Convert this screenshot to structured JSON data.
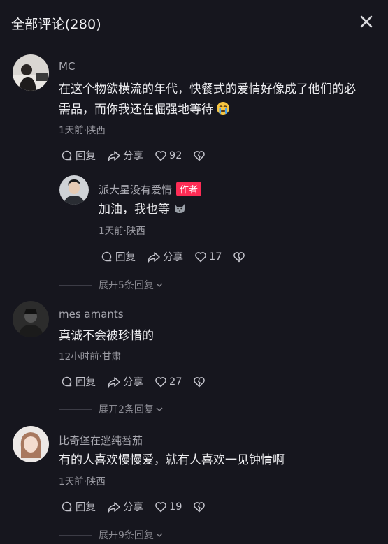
{
  "header": {
    "title": "全部评论(280)"
  },
  "comments": [
    {
      "username": "MC",
      "content_line1": "在这个物欲横流的年代，快餐式的爱情好像成了他们的必",
      "content_line2": "需品，而你我还在倔强地等待",
      "content_emoji": "crying-emoji",
      "meta": "1天前·陕西",
      "reply_label": "回复",
      "share_label": "分享",
      "likes": "92",
      "reply": {
        "username": "派大星没有爱情",
        "author_tag": "作者",
        "content": "加油，我也等",
        "content_emoji": "cat-emoji",
        "meta": "1天前·陕西",
        "reply_label": "回复",
        "share_label": "分享",
        "likes": "17"
      },
      "expand_label": "展开5条回复"
    },
    {
      "username": "mes amants",
      "content": "真诚不会被珍惜的",
      "meta": "12小时前·甘肃",
      "reply_label": "回复",
      "share_label": "分享",
      "likes": "27",
      "expand_label": "展开2条回复"
    },
    {
      "username": "比奇堡在逃纯番茄",
      "content": "有的人喜欢慢慢爱，就有人喜欢一见钟情啊",
      "meta": "1天前·陕西",
      "reply_label": "回复",
      "share_label": "分享",
      "likes": "19",
      "expand_label": "展开9条回复"
    }
  ],
  "colors": {
    "accent": "#fe2c55",
    "background": "#16161e"
  }
}
